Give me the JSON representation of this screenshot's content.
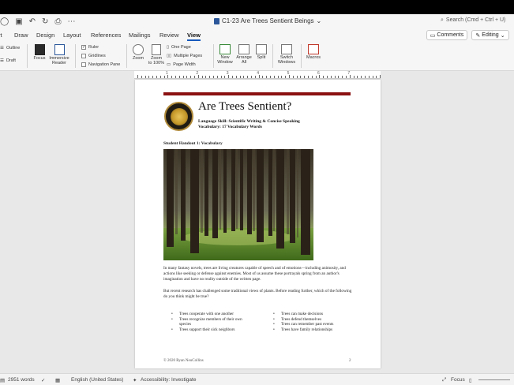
{
  "title_bar": {
    "doc_name": "C1-23 Are Trees Sentient Beings",
    "search_placeholder": "Search (Cmd + Ctrl + U)"
  },
  "tabs": [
    "rt",
    "Draw",
    "Design",
    "Layout",
    "References",
    "Mailings",
    "Review",
    "View"
  ],
  "active_tab": "View",
  "header_buttons": {
    "comments": "Comments",
    "editing": "Editing"
  },
  "ribbon": {
    "outline": "Outline",
    "draft": "Draft",
    "focus": "Focus",
    "immersive_reader": [
      "Immersive",
      "Reader"
    ],
    "ruler": "Ruler",
    "gridlines": "Gridlines",
    "navigation_pane": "Navigation Pane",
    "zoom": "Zoom",
    "zoom_100": [
      "Zoom",
      "to 100%"
    ],
    "one_page": "One Page",
    "multiple_pages": "Multiple Pages",
    "page_width": "Page Width",
    "new_window": [
      "New",
      "Window"
    ],
    "arrange_all": [
      "Arrange",
      "All"
    ],
    "split": "Split",
    "switch_windows": [
      "Switch",
      "Windows"
    ],
    "macros": "Macros"
  },
  "ruler_numbers": [
    "1",
    "2",
    "3",
    "4",
    "5",
    "6",
    "7"
  ],
  "document": {
    "title": "Are Trees Sentient?",
    "subtitle_line1": "Language Skill: Scientific Writing & Concise Speaking",
    "subtitle_line2": "Vocabulary: 17 Vocabulary Words",
    "handout": "Student Handout 1: Vocabulary",
    "para1": "In many fantasy novels, trees are living creatures capable of speech and of emotions—including animosity, and actions like seeking or defense against enemies. Most of us assume these portrayals spring from an author's imagination and have no reality outside of the written page.",
    "para2": "But recent research has challenged some traditional views of plants. Before reading further, which of the following do you think might be true?",
    "bullets_left": [
      "Trees cooperate with one another",
      "Trees recognize members of their own species",
      "Trees support their sick neighbors"
    ],
    "bullets_right": [
      "Trees can make decisions",
      "Trees defend themselves",
      "Trees can remember past events",
      "Trees have family relationships"
    ],
    "footer_left": "© 2020 Ryan NeuCollins",
    "footer_right": "2"
  },
  "status_bar": {
    "words": "2951 words",
    "language": "English (United States)",
    "accessibility": "Accessibility: Investigate",
    "focus": "Focus"
  },
  "colors": {
    "accent": "#185abd",
    "title_rule": "#8b1111"
  }
}
